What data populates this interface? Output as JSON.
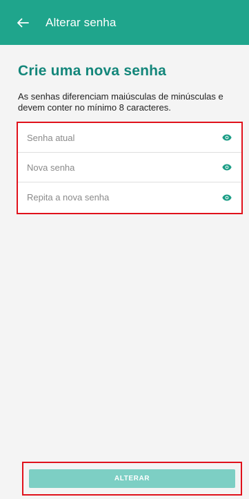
{
  "app_bar": {
    "title": "Alterar senha",
    "back_icon": "arrow-left-icon",
    "color": "#1fa58c"
  },
  "heading": "Crie uma nova senha",
  "description": "As senhas diferenciam maiúsculas de minúsculas e devem conter no mínimo 8 caracteres.",
  "fields": [
    {
      "placeholder": "Senha atual",
      "value": "",
      "icon": "eye-icon"
    },
    {
      "placeholder": "Nova senha",
      "value": "",
      "icon": "eye-icon"
    },
    {
      "placeholder": "Repita a nova senha",
      "value": "",
      "icon": "eye-icon"
    }
  ],
  "submit_button": {
    "label": "ALTERAR",
    "color": "#7dcfc4"
  },
  "colors": {
    "accent": "#1fa58c",
    "heading": "#13867a",
    "highlight_border": "#e0111b",
    "icon": "#1d9e87"
  }
}
